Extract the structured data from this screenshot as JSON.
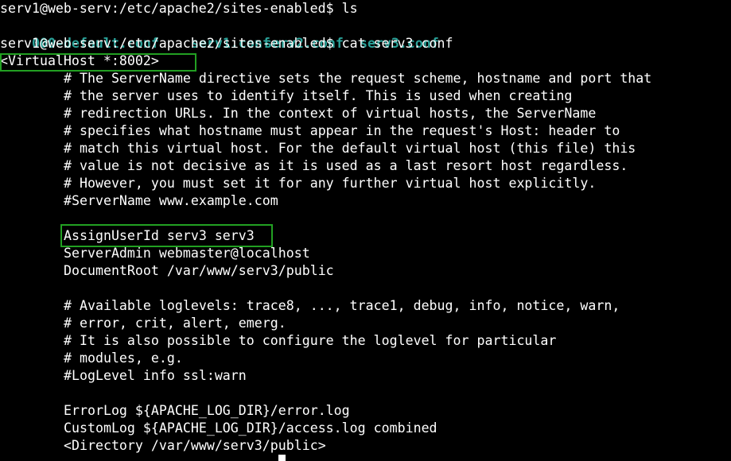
{
  "terminal": {
    "prompt_ls": "serv1@web-serv:/etc/apache2/sites-enabled$ ls",
    "files": [
      "000-default.conf",
      "serv1.conf",
      "serv2.conf",
      "serv3.conf"
    ],
    "file_color": "#2aa198",
    "prompt_cat": "serv1@web-serv:/etc/apache2/sites-enabled$ cat serv3.conf",
    "vhost_open": "<VirtualHost *:8002>",
    "comment_lines": [
      "# The ServerName directive sets the request scheme, hostname and port that",
      "# the server uses to identify itself. This is used when creating",
      "# redirection URLs. In the context of virtual hosts, the ServerName",
      "# specifies what hostname must appear in the request's Host: header to",
      "# match this virtual host. For the default virtual host (this file) this",
      "# value is not decisive as it is used as a last resort host regardless.",
      "# However, you must set it for any further virtual host explicitly."
    ],
    "servername": "#ServerName www.example.com",
    "assign_userid": "AssignUserId serv3 serv3",
    "server_admin": "ServerAdmin webmaster@localhost",
    "document_root": "DocumentRoot /var/www/serv3/public",
    "loglevel_comments": [
      "# Available loglevels: trace8, ..., trace1, debug, info, notice, warn,",
      "# error, crit, alert, emerg.",
      "# It is also possible to configure the loglevel for particular",
      "# modules, e.g."
    ],
    "loglevel": "#LogLevel info ssl:warn",
    "error_log": "ErrorLog ${APACHE_LOG_DIR}/error.log",
    "custom_log": "CustomLog ${APACHE_LOG_DIR}/access.log combined",
    "directory_open": "<Directory /var/www/serv3/public>",
    "highlight_color": "#22a022"
  }
}
